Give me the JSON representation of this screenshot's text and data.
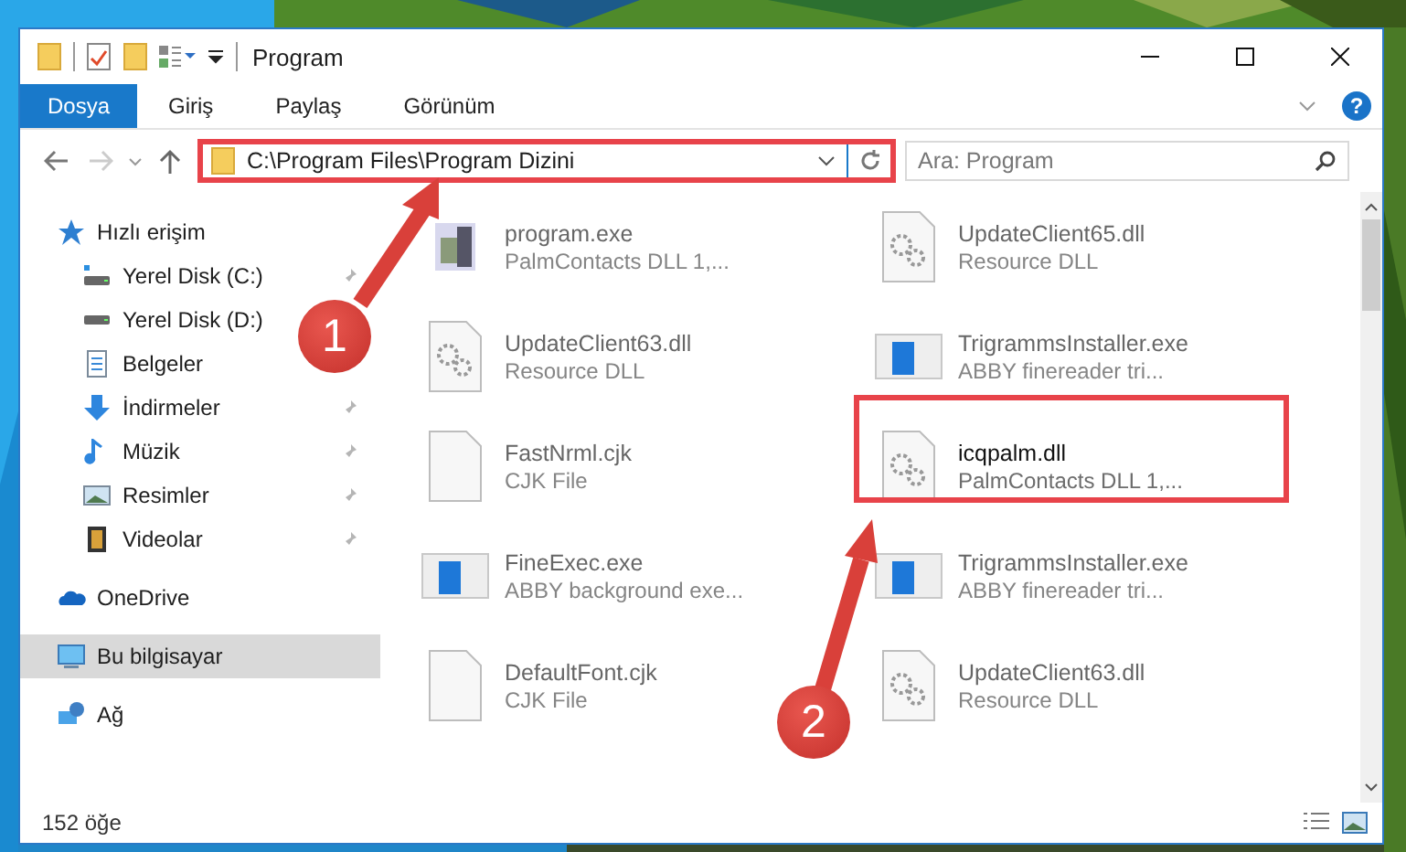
{
  "window": {
    "title": "Program"
  },
  "tabs": [
    {
      "label": "Dosya",
      "selected": true
    },
    {
      "label": "Giriş",
      "selected": false
    },
    {
      "label": "Paylaş",
      "selected": false
    },
    {
      "label": "Görünüm",
      "selected": false
    }
  ],
  "help_glyph": "?",
  "address": {
    "path": "C:\\Program Files\\Program Dizini",
    "highlighted": true
  },
  "search": {
    "placeholder": "Ara: Program"
  },
  "sidebar": {
    "items": [
      {
        "label": "Hızlı erişim",
        "kind": "star",
        "selected": false,
        "children": [
          {
            "label": "Yerel Disk (C:)",
            "kind": "system-drive",
            "pinned": true
          },
          {
            "label": "Yerel Disk (D:)",
            "kind": "drive"
          },
          {
            "label": "Belgeler",
            "kind": "documents"
          },
          {
            "label": "İndirmeler",
            "kind": "downloads",
            "pinned": true
          },
          {
            "label": "Müzik",
            "kind": "music",
            "pinned": true
          },
          {
            "label": "Resimler",
            "kind": "pictures",
            "pinned": true
          },
          {
            "label": "Videolar",
            "kind": "videos",
            "pinned": true
          }
        ]
      },
      {
        "label": "OneDrive",
        "kind": "cloud",
        "selected": false
      },
      {
        "label": "Bu bilgisayar",
        "kind": "computer",
        "selected": true
      },
      {
        "label": "Ağ",
        "kind": "network",
        "selected": false
      }
    ]
  },
  "files": [
    {
      "name": "program.exe",
      "description": "PalmContacts DLL 1,...",
      "kind": "exe",
      "highlighted": false
    },
    {
      "name": "UpdateClient65.dll",
      "description": "Resource DLL",
      "kind": "dll",
      "highlighted": false
    },
    {
      "name": "UpdateClient63.dll",
      "description": "Resource DLL",
      "kind": "dll",
      "highlighted": false
    },
    {
      "name": "TrigrammsInstaller.exe",
      "description": "ABBY finereader tri...",
      "kind": "app",
      "highlighted": false
    },
    {
      "name": "FastNrml.cjk",
      "description": "CJK File",
      "kind": "file",
      "highlighted": false
    },
    {
      "name": "icqpalm.dll",
      "description": "PalmContacts DLL 1,...",
      "kind": "dll",
      "highlighted": true
    },
    {
      "name": "FineExec.exe",
      "description": "ABBY background exe...",
      "kind": "app",
      "highlighted": false
    },
    {
      "name": "TrigrammsInstaller.exe",
      "description": "ABBY finereader tri...",
      "kind": "app",
      "highlighted": false
    },
    {
      "name": "DefaultFont.cjk",
      "description": "CJK File",
      "kind": "file",
      "highlighted": false
    },
    {
      "name": "UpdateClient63.dll",
      "description": "Resource DLL",
      "kind": "dll",
      "highlighted": false
    }
  ],
  "status_bar": {
    "count": "152 öğe"
  },
  "callouts": [
    {
      "number": "1"
    },
    {
      "number": "2"
    }
  ]
}
